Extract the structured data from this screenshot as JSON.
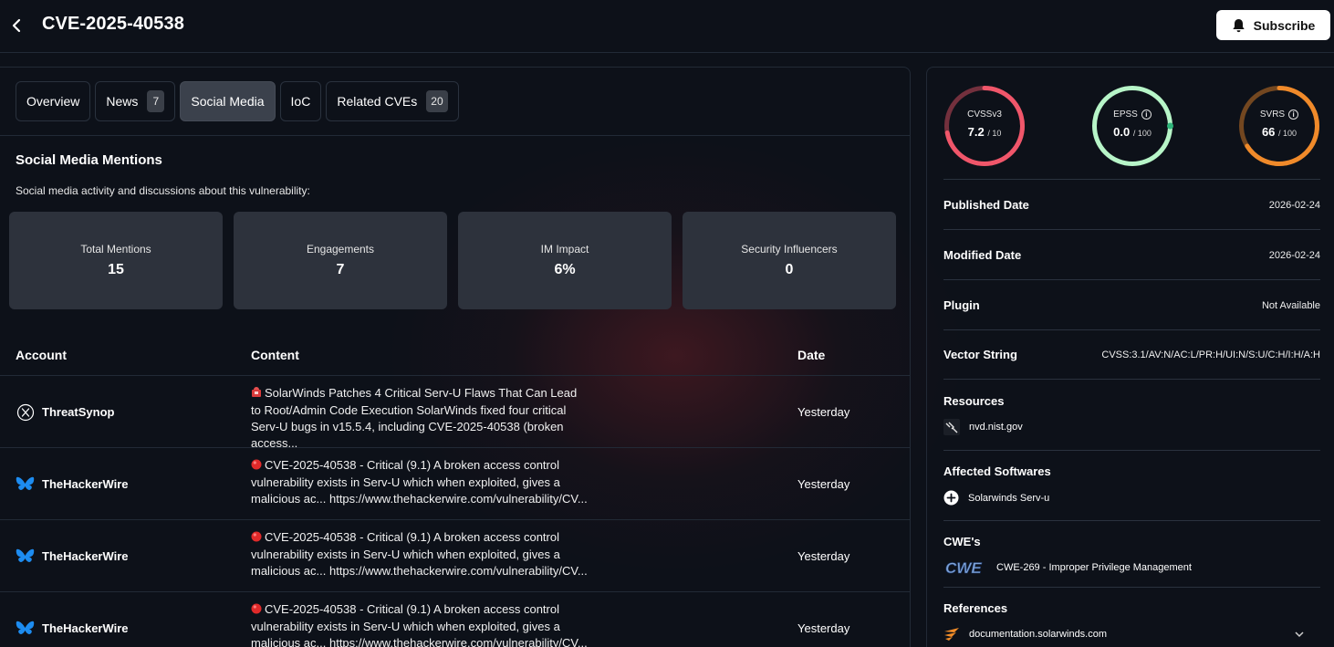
{
  "header": {
    "title": "CVE-2025-40538",
    "subscribe_label": "Subscribe"
  },
  "tabs": [
    {
      "label": "Overview",
      "badge": null,
      "active": false
    },
    {
      "label": "News",
      "badge": "7",
      "active": false
    },
    {
      "label": "Social Media",
      "badge": null,
      "active": true
    },
    {
      "label": "IoC",
      "badge": null,
      "active": false
    },
    {
      "label": "Related CVEs",
      "badge": "20",
      "active": false
    }
  ],
  "social": {
    "title": "Social Media Mentions",
    "description": "Social media activity and discussions about this vulnerability:",
    "stats": [
      {
        "label": "Total Mentions",
        "value": "15"
      },
      {
        "label": "Engagements",
        "value": "7"
      },
      {
        "label": "IM Impact",
        "value": "6%"
      },
      {
        "label": "Security Influencers",
        "value": "0"
      }
    ],
    "columns": {
      "account": "Account",
      "content": "Content",
      "date": "Date"
    },
    "rows": [
      {
        "icon": "x-twitter-icon",
        "account": "ThreatSynop",
        "emoji": "alarm-emoji",
        "content": "SolarWinds Patches 4 Critical Serv-U Flaws That Can Lead to Root/Admin Code Execution SolarWinds fixed four critical Serv-U bugs in v15.5.4, including CVE-2025-40538 (broken access...",
        "date": "Yesterday"
      },
      {
        "icon": "bluesky-icon",
        "account": "TheHackerWire",
        "emoji": "red-circle-emoji",
        "content": "CVE-2025-40538 - Critical (9.1) A broken access control vulnerability exists in Serv-U which when exploited, gives a malicious ac... https://www.thehackerwire.com/vulnerability/CV...",
        "date": "Yesterday"
      },
      {
        "icon": "bluesky-icon",
        "account": "TheHackerWire",
        "emoji": "red-circle-emoji",
        "content": "CVE-2025-40538 - Critical (9.1) A broken access control vulnerability exists in Serv-U which when exploited, gives a malicious ac... https://www.thehackerwire.com/vulnerability/CV...",
        "date": "Yesterday"
      },
      {
        "icon": "bluesky-icon",
        "account": "TheHackerWire",
        "emoji": "red-circle-emoji",
        "content": "CVE-2025-40538 - Critical (9.1) A broken access control vulnerability exists in Serv-U which when exploited, gives a malicious ac... https://www.thehackerwire.com/vulnerability/CV...",
        "date": "Yesterday"
      }
    ]
  },
  "scores": [
    {
      "label": "CVSSv3",
      "value": "7.2",
      "max": "/ 10",
      "fraction": 0.72,
      "color": "#f0566a",
      "info": false
    },
    {
      "label": "EPSS",
      "value": "0.0",
      "max": "/ 100",
      "fraction": 0.0,
      "color": "#b7f5c8",
      "info": true
    },
    {
      "label": "SVRS",
      "value": "66",
      "max": "/ 100",
      "fraction": 0.66,
      "color": "#f08a2a",
      "info": true
    }
  ],
  "details": {
    "published_label": "Published Date",
    "published_value": "2026-02-24",
    "modified_label": "Modified Date",
    "modified_value": "2026-02-24",
    "plugin_label": "Plugin",
    "plugin_value": "Not Available",
    "vector_label": "Vector String",
    "vector_value": "CVSS:3.1/AV:N/AC:L/PR:H/UI:N/S:U/C:H/I:H/A:H",
    "resources_label": "Resources",
    "resources": [
      "nvd.nist.gov"
    ],
    "affected_label": "Affected Softwares",
    "affected": [
      "Solarwinds Serv-u"
    ],
    "cwe_label": "CWE's",
    "cwe_logo": "CWE",
    "cwes": [
      "CWE-269 - Improper Privilege Management"
    ],
    "references_label": "References",
    "references": [
      "documentation.solarwinds.com"
    ]
  }
}
